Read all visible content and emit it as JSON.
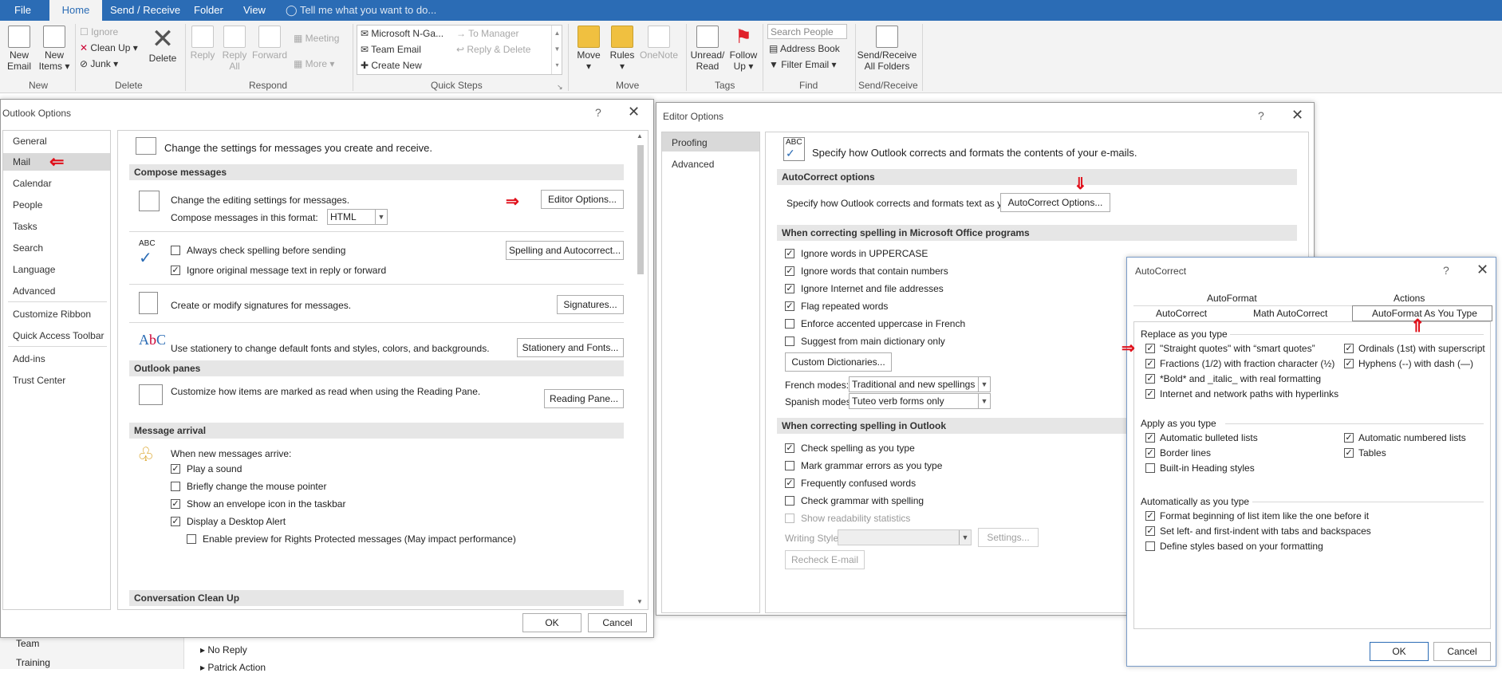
{
  "tabs": [
    {
      "label": "File"
    },
    {
      "label": "Home"
    },
    {
      "label": "Send / Receive"
    },
    {
      "label": "Folder"
    },
    {
      "label": "View"
    }
  ],
  "tell_me": "Tell me what you want to do...",
  "ribbon": {
    "new_email": "New\nEmail",
    "new_items": "New\nItems ▾",
    "ignore": "Ignore",
    "clean_up": "Clean Up ▾",
    "junk": "Junk ▾",
    "delete": "Delete",
    "reply": "Reply",
    "reply_all": "Reply\nAll",
    "forward": "Forward",
    "meeting": "Meeting",
    "more": "More ▾",
    "qs1": "Microsoft N-Ga...",
    "qs2": "Team Email",
    "qs3": "Create New",
    "qs4": "To Manager",
    "qs5": "Reply & Delete",
    "move": "Move",
    "rules": "Rules",
    "onenote": "OneNote",
    "unread_read": "Unread/\nRead",
    "follow_up": "Follow\nUp ▾",
    "search_people": "Search People",
    "address_book": "Address Book",
    "filter_email": "Filter Email ▾",
    "send_receive_all": "Send/Receive\nAll Folders",
    "groups": {
      "new": "New",
      "delete": "Delete",
      "respond": "Respond",
      "quick_steps": "Quick Steps",
      "move": "Move",
      "tags": "Tags",
      "find": "Find",
      "send_receive": "Send/Receive"
    }
  },
  "background_list": [
    "Team",
    "Training",
    "No Reply",
    "Patrick Action"
  ],
  "outlook_options": {
    "title": "Outlook Options",
    "help": "?",
    "close": "✕",
    "nav": [
      "General",
      "Mail",
      "Calendar",
      "People",
      "Tasks",
      "Search",
      "Language",
      "Advanced",
      "Customize Ribbon",
      "Quick Access Toolbar",
      "Add-ins",
      "Trust Center"
    ],
    "header": "Change the settings for messages you create and receive.",
    "compose_head": "Compose messages",
    "editing": "Change the editing settings for messages.",
    "editor_btn": "Editor Options...",
    "compose_format_label": "Compose messages in this format:",
    "compose_format_value": "HTML",
    "always_check": "Always check spelling before sending",
    "ignore_original": "Ignore original message text in reply or forward",
    "spelling_btn": "Spelling and Autocorrect...",
    "signatures_text": "Create or modify signatures for messages.",
    "signatures_btn": "Signatures...",
    "stationery_text": "Use stationery to change default fonts and styles, colors, and backgrounds.",
    "stationery_btn": "Stationery and Fonts...",
    "panes_head": "Outlook panes",
    "panes_text": "Customize how items are marked as read when using the Reading Pane.",
    "reading_btn": "Reading Pane...",
    "arrival_head": "Message arrival",
    "arrival_text": "When new messages arrive:",
    "play_sound": "Play a sound",
    "change_pointer": "Briefly change the mouse pointer",
    "envelope_icon": "Show an envelope icon in the taskbar",
    "desktop_alert": "Display a Desktop Alert",
    "enable_preview": "Enable preview for Rights Protected messages (May impact performance)",
    "cleanup_head": "Conversation Clean Up",
    "ok": "OK",
    "cancel": "Cancel"
  },
  "editor_options": {
    "title": "Editor Options",
    "help": "?",
    "close": "✕",
    "nav": [
      "Proofing",
      "Advanced"
    ],
    "header": "Specify how Outlook corrects and formats the contents of your e-mails.",
    "autocorrect_head": "AutoCorrect options",
    "autocorrect_text": "Specify how Outlook corrects and formats text as you type.",
    "autocorrect_btn": "AutoCorrect Options...",
    "office_head": "When correcting spelling in Microsoft Office programs",
    "office_items": [
      "Ignore words in UPPERCASE",
      "Ignore words that contain numbers",
      "Ignore Internet and file addresses",
      "Flag repeated words",
      "Enforce accented uppercase in French",
      "Suggest from main dictionary only"
    ],
    "custom_dict_btn": "Custom Dictionaries...",
    "french_label": "French modes:",
    "french_value": "Traditional and new spellings",
    "spanish_label": "Spanish modes:",
    "spanish_value": "Tuteo verb forms only",
    "outlook_head": "When correcting spelling in Outlook",
    "outlook_items": [
      "Check spelling as you type",
      "Mark grammar errors as you type",
      "Frequently confused words",
      "Check grammar with spelling",
      "Show readability statistics"
    ],
    "writing_style_label": "Writing Style:",
    "settings_btn": "Settings...",
    "recheck_btn": "Recheck E-mail"
  },
  "autocorrect": {
    "title": "AutoCorrect",
    "help": "?",
    "close": "✕",
    "tabs_top": [
      "AutoFormat",
      "Actions"
    ],
    "tabs_bottom": [
      "AutoCorrect",
      "Math AutoCorrect",
      "AutoFormat As You Type"
    ],
    "replace_head": "Replace as you type",
    "replace_left": [
      "\"Straight quotes\" with “smart quotes”",
      "Fractions (1/2) with fraction character (½)",
      "*Bold* and _italic_ with real formatting",
      "Internet and network paths with hyperlinks"
    ],
    "replace_right": [
      "Ordinals (1st) with superscript",
      "Hyphens (--) with dash (—)"
    ],
    "apply_head": "Apply as you type",
    "apply_left": [
      "Automatic bulleted lists",
      "Border lines",
      "Built-in Heading styles"
    ],
    "apply_right": [
      "Automatic numbered lists",
      "Tables"
    ],
    "auto_head": "Automatically as you type",
    "auto_items": [
      "Format beginning of list item like the one before it",
      "Set left- and first-indent with tabs and backspaces",
      "Define styles based on your formatting"
    ],
    "ok": "OK",
    "cancel": "Cancel"
  },
  "colors": {
    "accent": "#2b6cb5",
    "arrow": "#e0101b",
    "selected_nav": "#d9d9d9"
  }
}
